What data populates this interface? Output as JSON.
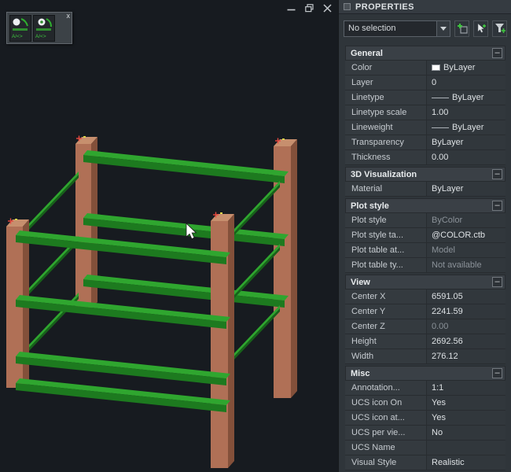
{
  "viewport": {
    "background": "#171b20",
    "toolbar_close_label": "x",
    "tool_tiles": [
      {
        "caption": "A/<>"
      },
      {
        "caption": "A/<>"
      }
    ],
    "window_controls": {
      "minimize": "minimize-icon",
      "restore": "restore-down-icon",
      "close": "close-icon"
    },
    "model": {
      "post_color": "#b07056",
      "post_side_color": "#83503a",
      "post_top_color": "#c78f6e",
      "rail_color": "#1d7a1f",
      "rail_top_color": "#2fa62f",
      "marker_color": "#e8483f"
    }
  },
  "properties_panel": {
    "title": "PROPERTIES",
    "selection_value": "No selection",
    "toolbar_buttons": [
      "toggle-pickadd",
      "select-objects",
      "quick-select"
    ],
    "sections": [
      {
        "title": "General",
        "rows": [
          {
            "label": "Color",
            "value": "ByLayer",
            "swatch": true
          },
          {
            "label": "Layer",
            "value": "0"
          },
          {
            "label": "Linetype",
            "value": "ByLayer",
            "line": true
          },
          {
            "label": "Linetype scale",
            "value": "1.00"
          },
          {
            "label": "Lineweight",
            "value": "ByLayer",
            "line": true
          },
          {
            "label": "Transparency",
            "value": "ByLayer"
          },
          {
            "label": "Thickness",
            "value": "0.00"
          }
        ]
      },
      {
        "title": "3D Visualization",
        "rows": [
          {
            "label": "Material",
            "value": "ByLayer"
          }
        ]
      },
      {
        "title": "Plot style",
        "rows": [
          {
            "label": "Plot style",
            "value": "ByColor",
            "muted": true
          },
          {
            "label": "Plot style ta...",
            "value": "@COLOR.ctb"
          },
          {
            "label": "Plot table at...",
            "value": "Model",
            "muted": true
          },
          {
            "label": "Plot table ty...",
            "value": "Not available",
            "muted": true
          }
        ]
      },
      {
        "title": "View",
        "rows": [
          {
            "label": "Center X",
            "value": "6591.05"
          },
          {
            "label": "Center Y",
            "value": "2241.59"
          },
          {
            "label": "Center Z",
            "value": "0.00",
            "muted": true
          },
          {
            "label": "Height",
            "value": "2692.56"
          },
          {
            "label": "Width",
            "value": "276.12"
          }
        ]
      },
      {
        "title": "Misc",
        "rows": [
          {
            "label": "Annotation...",
            "value": "1:1"
          },
          {
            "label": "UCS icon On",
            "value": "Yes"
          },
          {
            "label": "UCS icon at...",
            "value": "Yes"
          },
          {
            "label": "UCS per vie...",
            "value": "No"
          },
          {
            "label": "UCS Name",
            "value": ""
          },
          {
            "label": "Visual Style",
            "value": "Realistic"
          }
        ]
      }
    ]
  },
  "ui": {
    "collapse_glyph": "–"
  }
}
